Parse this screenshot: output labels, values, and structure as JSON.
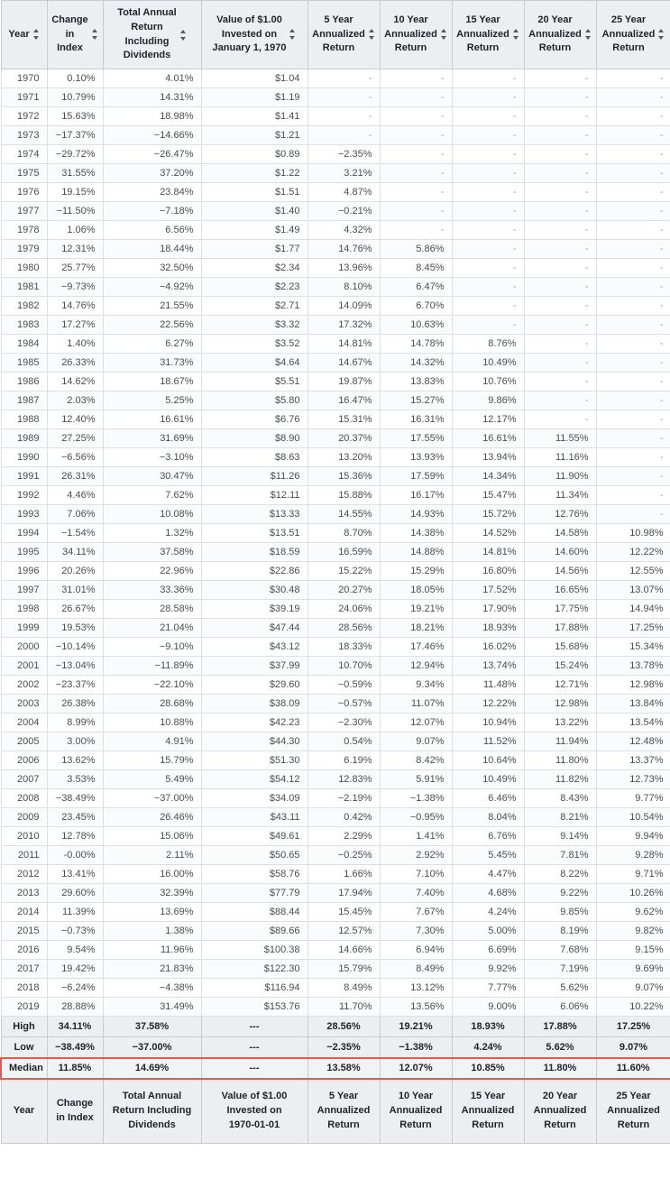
{
  "table": {
    "header": {
      "columns": [
        {
          "label": "Year",
          "sortable": true
        },
        {
          "label": "Change\nin Index",
          "sortable": true
        },
        {
          "label": "Total Annual\nReturn\nIncluding\nDividends",
          "sortable": true
        },
        {
          "label": "Value of $1.00\nInvested on\nJanuary 1, 1970",
          "sortable": true
        },
        {
          "label": "5 Year\nAnnualized\nReturn",
          "sortable": true
        },
        {
          "label": "10 Year\nAnnualized\nReturn",
          "sortable": true
        },
        {
          "label": "15 Year\nAnnualized\nReturn",
          "sortable": true
        },
        {
          "label": "20 Year\nAnnualized\nReturn",
          "sortable": true
        },
        {
          "label": "25 Year\nAnnualized\nReturn",
          "sortable": true
        }
      ]
    },
    "footer": {
      "columns": [
        {
          "label": "Year"
        },
        {
          "label": "Change\nin Index"
        },
        {
          "label": "Total Annual\nReturn Including\nDividends"
        },
        {
          "label": "Value of $1.00\nInvested on\n1970-01-01"
        },
        {
          "label": "5 Year\nAnnualized\nReturn"
        },
        {
          "label": "10 Year\nAnnualized\nReturn"
        },
        {
          "label": "15 Year\nAnnualized\nReturn"
        },
        {
          "label": "20 Year\nAnnualized\nReturn"
        },
        {
          "label": "25 Year\nAnnualized\nReturn"
        }
      ]
    },
    "empty_marker": "-",
    "summary_dash": "---",
    "rows": [
      [
        "1970",
        "0.10%",
        "4.01%",
        "$1.04",
        "-",
        "-",
        "-",
        "-",
        "-"
      ],
      [
        "1971",
        "10.79%",
        "14.31%",
        "$1.19",
        "-",
        "-",
        "-",
        "-",
        "-"
      ],
      [
        "1972",
        "15.63%",
        "18.98%",
        "$1.41",
        "-",
        "-",
        "-",
        "-",
        "-"
      ],
      [
        "1973",
        "−17.37%",
        "−14.66%",
        "$1.21",
        "-",
        "-",
        "-",
        "-",
        "-"
      ],
      [
        "1974",
        "−29.72%",
        "−26.47%",
        "$0.89",
        "−2.35%",
        "-",
        "-",
        "-",
        "-"
      ],
      [
        "1975",
        "31.55%",
        "37.20%",
        "$1.22",
        "3.21%",
        "-",
        "-",
        "-",
        "-"
      ],
      [
        "1976",
        "19.15%",
        "23.84%",
        "$1.51",
        "4.87%",
        "-",
        "-",
        "-",
        "-"
      ],
      [
        "1977",
        "−11.50%",
        "−7.18%",
        "$1.40",
        "−0.21%",
        "-",
        "-",
        "-",
        "-"
      ],
      [
        "1978",
        "1.06%",
        "6.56%",
        "$1.49",
        "4.32%",
        "-",
        "-",
        "-",
        "-"
      ],
      [
        "1979",
        "12.31%",
        "18.44%",
        "$1.77",
        "14.76%",
        "5.86%",
        "-",
        "-",
        "-"
      ],
      [
        "1980",
        "25.77%",
        "32.50%",
        "$2.34",
        "13.96%",
        "8.45%",
        "-",
        "-",
        "-"
      ],
      [
        "1981",
        "−9.73%",
        "−4.92%",
        "$2.23",
        "8.10%",
        "6.47%",
        "-",
        "-",
        "-"
      ],
      [
        "1982",
        "14.76%",
        "21.55%",
        "$2.71",
        "14.09%",
        "6.70%",
        "-",
        "-",
        "-"
      ],
      [
        "1983",
        "17.27%",
        "22.56%",
        "$3.32",
        "17.32%",
        "10.63%",
        "-",
        "-",
        "-"
      ],
      [
        "1984",
        "1.40%",
        "6.27%",
        "$3.52",
        "14.81%",
        "14.78%",
        "8.76%",
        "-",
        "-"
      ],
      [
        "1985",
        "26.33%",
        "31.73%",
        "$4.64",
        "14.67%",
        "14.32%",
        "10.49%",
        "-",
        "-"
      ],
      [
        "1986",
        "14.62%",
        "18.67%",
        "$5.51",
        "19.87%",
        "13.83%",
        "10.76%",
        "-",
        "-"
      ],
      [
        "1987",
        "2.03%",
        "5.25%",
        "$5.80",
        "16.47%",
        "15.27%",
        "9.86%",
        "-",
        "-"
      ],
      [
        "1988",
        "12.40%",
        "16.61%",
        "$6.76",
        "15.31%",
        "16.31%",
        "12.17%",
        "-",
        "-"
      ],
      [
        "1989",
        "27.25%",
        "31.69%",
        "$8.90",
        "20.37%",
        "17.55%",
        "16.61%",
        "11.55%",
        "-"
      ],
      [
        "1990",
        "−6.56%",
        "−3.10%",
        "$8.63",
        "13.20%",
        "13.93%",
        "13.94%",
        "11.16%",
        "-"
      ],
      [
        "1991",
        "26.31%",
        "30.47%",
        "$11.26",
        "15.36%",
        "17.59%",
        "14.34%",
        "11.90%",
        "-"
      ],
      [
        "1992",
        "4.46%",
        "7.62%",
        "$12.11",
        "15.88%",
        "16.17%",
        "15.47%",
        "11.34%",
        "-"
      ],
      [
        "1993",
        "7.06%",
        "10.08%",
        "$13.33",
        "14.55%",
        "14.93%",
        "15.72%",
        "12.76%",
        "-"
      ],
      [
        "1994",
        "−1.54%",
        "1.32%",
        "$13.51",
        "8.70%",
        "14.38%",
        "14.52%",
        "14.58%",
        "10.98%"
      ],
      [
        "1995",
        "34.11%",
        "37.58%",
        "$18.59",
        "16.59%",
        "14.88%",
        "14.81%",
        "14.60%",
        "12.22%"
      ],
      [
        "1996",
        "20.26%",
        "22.96%",
        "$22.86",
        "15.22%",
        "15.29%",
        "16.80%",
        "14.56%",
        "12.55%"
      ],
      [
        "1997",
        "31.01%",
        "33.36%",
        "$30.48",
        "20.27%",
        "18.05%",
        "17.52%",
        "16.65%",
        "13.07%"
      ],
      [
        "1998",
        "26.67%",
        "28.58%",
        "$39.19",
        "24.06%",
        "19.21%",
        "17.90%",
        "17.75%",
        "14.94%"
      ],
      [
        "1999",
        "19.53%",
        "21.04%",
        "$47.44",
        "28.56%",
        "18.21%",
        "18.93%",
        "17.88%",
        "17.25%"
      ],
      [
        "2000",
        "−10.14%",
        "−9.10%",
        "$43.12",
        "18.33%",
        "17.46%",
        "16.02%",
        "15.68%",
        "15.34%"
      ],
      [
        "2001",
        "−13.04%",
        "−11.89%",
        "$37.99",
        "10.70%",
        "12.94%",
        "13.74%",
        "15.24%",
        "13.78%"
      ],
      [
        "2002",
        "−23.37%",
        "−22.10%",
        "$29.60",
        "−0.59%",
        "9.34%",
        "11.48%",
        "12.71%",
        "12.98%"
      ],
      [
        "2003",
        "26.38%",
        "28.68%",
        "$38.09",
        "−0.57%",
        "11.07%",
        "12.22%",
        "12.98%",
        "13.84%"
      ],
      [
        "2004",
        "8.99%",
        "10.88%",
        "$42.23",
        "−2.30%",
        "12.07%",
        "10.94%",
        "13.22%",
        "13.54%"
      ],
      [
        "2005",
        "3.00%",
        "4.91%",
        "$44.30",
        "0.54%",
        "9.07%",
        "11.52%",
        "11.94%",
        "12.48%"
      ],
      [
        "2006",
        "13.62%",
        "15.79%",
        "$51.30",
        "6.19%",
        "8.42%",
        "10.64%",
        "11.80%",
        "13.37%"
      ],
      [
        "2007",
        "3.53%",
        "5.49%",
        "$54.12",
        "12.83%",
        "5.91%",
        "10.49%",
        "11.82%",
        "12.73%"
      ],
      [
        "2008",
        "−38.49%",
        "−37.00%",
        "$34.09",
        "−2.19%",
        "−1.38%",
        "6.46%",
        "8.43%",
        "9.77%"
      ],
      [
        "2009",
        "23.45%",
        "26.46%",
        "$43.11",
        "0.42%",
        "−0.95%",
        "8.04%",
        "8.21%",
        "10.54%"
      ],
      [
        "2010",
        "12.78%",
        "15.06%",
        "$49.61",
        "2.29%",
        "1.41%",
        "6.76%",
        "9.14%",
        "9.94%"
      ],
      [
        "2011",
        "-0.00%",
        "2.11%",
        "$50.65",
        "−0.25%",
        "2.92%",
        "5.45%",
        "7.81%",
        "9.28%"
      ],
      [
        "2012",
        "13.41%",
        "16.00%",
        "$58.76",
        "1.66%",
        "7.10%",
        "4.47%",
        "8.22%",
        "9.71%"
      ],
      [
        "2013",
        "29.60%",
        "32.39%",
        "$77.79",
        "17.94%",
        "7.40%",
        "4.68%",
        "9.22%",
        "10.26%"
      ],
      [
        "2014",
        "11.39%",
        "13.69%",
        "$88.44",
        "15.45%",
        "7.67%",
        "4.24%",
        "9.85%",
        "9.62%"
      ],
      [
        "2015",
        "−0.73%",
        "1.38%",
        "$89.66",
        "12.57%",
        "7.30%",
        "5.00%",
        "8.19%",
        "9.82%"
      ],
      [
        "2016",
        "9.54%",
        "11.96%",
        "$100.38",
        "14.66%",
        "6.94%",
        "6.69%",
        "7.68%",
        "9.15%"
      ],
      [
        "2017",
        "19.42%",
        "21.83%",
        "$122.30",
        "15.79%",
        "8.49%",
        "9.92%",
        "7.19%",
        "9.69%"
      ],
      [
        "2018",
        "−6.24%",
        "−4.38%",
        "$116.94",
        "8.49%",
        "13.12%",
        "7.77%",
        "5.62%",
        "9.07%"
      ],
      [
        "2019",
        "28.88%",
        "31.49%",
        "$153.76",
        "11.70%",
        "13.56%",
        "9.00%",
        "6.06%",
        "10.22%"
      ]
    ],
    "summary_rows": [
      {
        "label": "High",
        "highlighted": false,
        "values": [
          "34.11%",
          "37.58%",
          "---",
          "28.56%",
          "19.21%",
          "18.93%",
          "17.88%",
          "17.25%"
        ]
      },
      {
        "label": "Low",
        "highlighted": false,
        "values": [
          "−38.49%",
          "−37.00%",
          "---",
          "−2.35%",
          "−1.38%",
          "4.24%",
          "5.62%",
          "9.07%"
        ]
      },
      {
        "label": "Median",
        "highlighted": true,
        "values": [
          "11.85%",
          "14.69%",
          "---",
          "13.58%",
          "12.07%",
          "10.85%",
          "11.80%",
          "11.60%"
        ]
      }
    ]
  },
  "colors": {
    "header_background": "#eceef1",
    "highlight_border": "#e8584f",
    "grid_line": "#dcdfe3",
    "text": "#4a4d52"
  }
}
